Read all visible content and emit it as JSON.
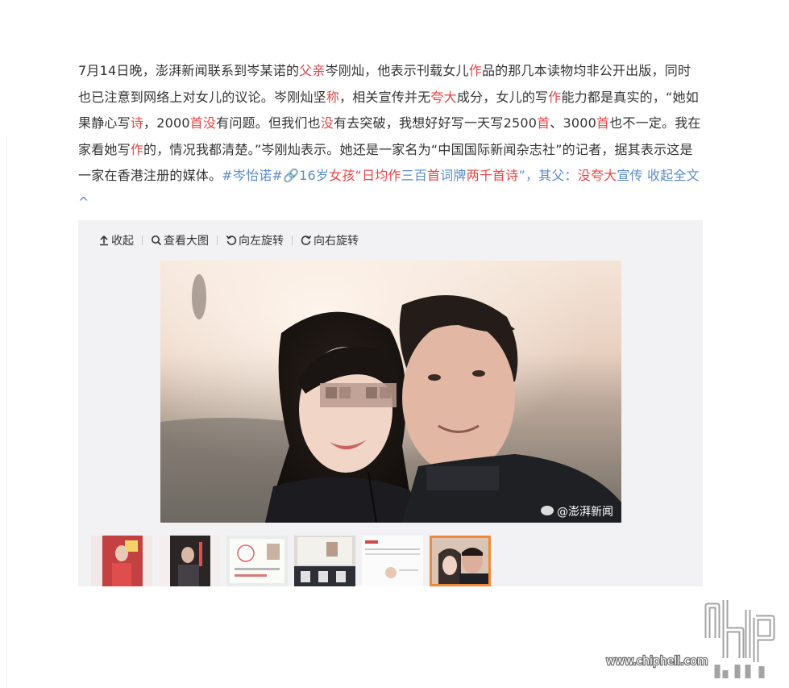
{
  "post": {
    "segments": [
      {
        "t": "7月14日晚，澎湃新闻联系到岑某诺的",
        "c": ""
      },
      {
        "t": "父亲",
        "c": "red"
      },
      {
        "t": "岑刚灿，他表示刊载女儿",
        "c": ""
      },
      {
        "t": "作",
        "c": "red"
      },
      {
        "t": "品的那几本读物均非公开出版，同时也已注意到网络上对女儿的议论。岑刚灿坚",
        "c": ""
      },
      {
        "t": "称",
        "c": "red"
      },
      {
        "t": "，相关宣传并无",
        "c": ""
      },
      {
        "t": "夸大",
        "c": "red"
      },
      {
        "t": "成分，女儿的写",
        "c": ""
      },
      {
        "t": "作",
        "c": "red"
      },
      {
        "t": "能力都是真实的，“她如果静心写",
        "c": ""
      },
      {
        "t": "诗",
        "c": "red"
      },
      {
        "t": "，2000",
        "c": ""
      },
      {
        "t": "首",
        "c": "red"
      },
      {
        "t": "没",
        "c": "red"
      },
      {
        "t": "有问题。但我们也",
        "c": ""
      },
      {
        "t": "没",
        "c": "red"
      },
      {
        "t": "有去突破，我想好好写一天写2500",
        "c": ""
      },
      {
        "t": "首",
        "c": "red"
      },
      {
        "t": "、3000",
        "c": ""
      },
      {
        "t": "首",
        "c": "red"
      },
      {
        "t": "也不一定。我在家看她写",
        "c": ""
      },
      {
        "t": "作",
        "c": "red"
      },
      {
        "t": "的，情况我都清楚。”岑刚灿表示。她还是一家名为“中国国际新闻杂志社”的记者，据其表示这是一家在香港注册的媒体。",
        "c": ""
      },
      {
        "t": "#岑怡诺#",
        "c": "tag"
      },
      {
        "t": "🔗",
        "c": "tag"
      },
      {
        "t": "16岁",
        "c": "tag"
      },
      {
        "t": "女孩",
        "c": "red"
      },
      {
        "t": "“日均",
        "c": "red"
      },
      {
        "t": "作",
        "c": "red"
      },
      {
        "t": "三百",
        "c": "tag"
      },
      {
        "t": "首",
        "c": "red"
      },
      {
        "t": "词牌",
        "c": "tag"
      },
      {
        "t": "两千",
        "c": "red"
      },
      {
        "t": "首",
        "c": "red"
      },
      {
        "t": "诗",
        "c": "red"
      },
      {
        "t": "”，其父：",
        "c": "tag"
      },
      {
        "t": "没",
        "c": "red"
      },
      {
        "t": "夸大",
        "c": "red"
      },
      {
        "t": "宣传",
        "c": "tag"
      },
      {
        "t": " 收起全文",
        "c": "link"
      },
      {
        "t": "^",
        "c": "link"
      }
    ]
  },
  "toolbar": {
    "collapse": "收起",
    "view_large": "查看大图",
    "rotate_left": "向左旋转",
    "rotate_right": "向右旋转"
  },
  "photo": {
    "watermark": "@澎湃新闻",
    "active_index": 5
  },
  "thumbnails": [
    "thumb-1",
    "thumb-2",
    "thumb-3",
    "thumb-4",
    "thumb-5",
    "thumb-6"
  ],
  "site_watermark": {
    "logo_text": "chip hell",
    "url": "www.chiphell.com"
  },
  "colors": {
    "link": "#5b8bc8",
    "highlight": "#e64747",
    "active_border": "#f08a3a"
  }
}
